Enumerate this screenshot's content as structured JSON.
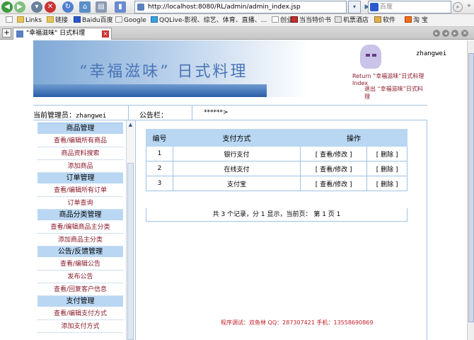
{
  "browser": {
    "address": "http://localhost:8080/RL/admin/admin_index.jsp",
    "search_placeholder": "百度",
    "bookmarks": [
      "Links",
      "链接",
      "Baidu百度",
      "Google",
      "QQLive-影视、综艺、体育、直播、...",
      "创业",
      "当当特价书",
      "机票酒店",
      "软件",
      "淘 宝"
    ],
    "tab_title": "\"幸福滋味\" 日式料理",
    "new_tab": "+",
    "tab_close": "×"
  },
  "header": {
    "site_title": "“幸福滋味” 日式料理",
    "username": "zhangwei",
    "return_link": "Return “幸福滋味”日式料理 Index",
    "logout_link": "退出 “幸福滋味”日式料理"
  },
  "infobar": {
    "current_admin_label": "当前管理员：",
    "current_admin_name": "zhangwei",
    "notice_label": "公告栏：",
    "notice_text": "******>"
  },
  "sidebar": {
    "sections": [
      {
        "title": "商品管理",
        "items": [
          "查看/编辑所有商品",
          "商品资料搜索",
          "添加商品"
        ]
      },
      {
        "title": "订单管理",
        "items": [
          "查看/编辑所有订单",
          "订单查询"
        ]
      },
      {
        "title": "商品分类管理",
        "items": [
          "查看/编辑商品主分类",
          "添加商品主分类"
        ]
      },
      {
        "title": "公告/反馈管理",
        "items": [
          "查看/编辑公告",
          "发布公告",
          "查看/回复客户信息"
        ]
      },
      {
        "title": "支付管理",
        "items": [
          "查看/编辑支付方式",
          "添加支付方式"
        ]
      }
    ]
  },
  "payment_table": {
    "headers": [
      "编号",
      "支付方式",
      "操作"
    ],
    "rows": [
      {
        "id": "1",
        "method": "银行支付",
        "edit": "[ 查看/修改 ]",
        "delete": "[ 删除 ]"
      },
      {
        "id": "2",
        "method": "在线支付",
        "edit": "[ 查看/修改 ]",
        "delete": "[ 删除 ]"
      },
      {
        "id": "3",
        "method": "支付宝",
        "edit": "[ 查看/修改 ]",
        "delete": "[ 删除 ]"
      }
    ],
    "pager": "共 3 个记录，分 1 显示，当前页： 第 1 页    1"
  },
  "footer_credit": "程序调试：双鱼林 QQ：287307421 手机：13558690869",
  "colors": {
    "header_blue": "#b9d7f3",
    "border_blue": "#9ec3e6",
    "link_dark_red": "#8a1a2a",
    "credit_red": "#c0202a"
  }
}
